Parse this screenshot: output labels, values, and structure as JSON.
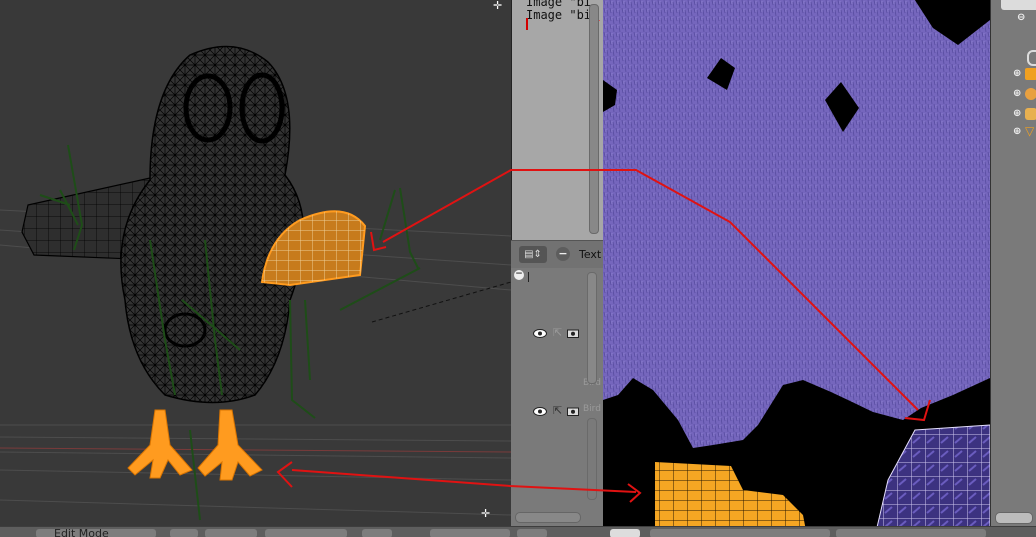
{
  "text_editor": {
    "code_lines": [
      "Image \"bi",
      "Image \"bi"
    ],
    "header_menu": "Text"
  },
  "outliner": {
    "rows": [
      {
        "label": "Bird"
      },
      {
        "label": "Bird"
      }
    ]
  },
  "bottom_bar": {
    "mode_label": "Edit Mode"
  },
  "colors": {
    "selection": "#ff9b1f",
    "wire": "#000000",
    "bone": "#1e4d18",
    "annotation": "#e01212",
    "texture": "#7566bd",
    "viewport_bg": "#393939"
  },
  "icons": [
    "plus-icon",
    "eye-icon",
    "camera-icon",
    "cursor-icon",
    "editor-type-icon"
  ]
}
